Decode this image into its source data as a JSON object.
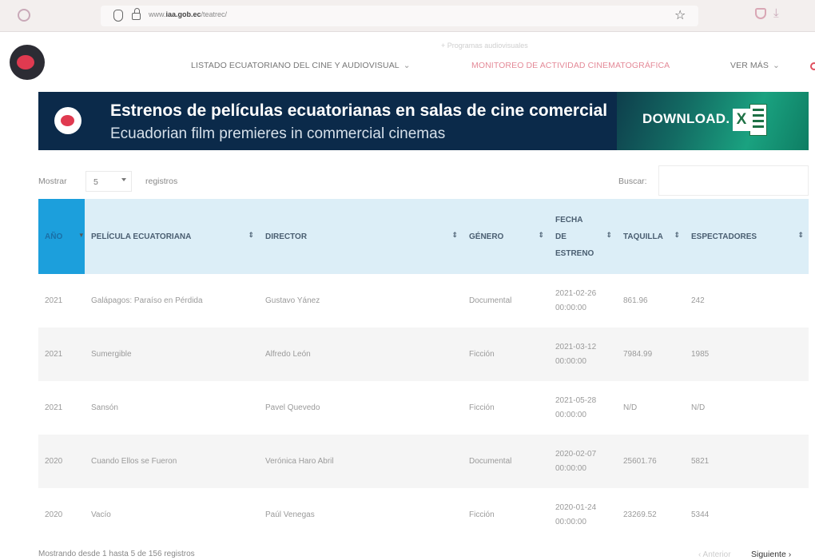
{
  "browser": {
    "url_prefix": "www.",
    "url_domain": "iaa.gob.ec",
    "url_path": "/teatrec/"
  },
  "nav": {
    "hint": "+ Programas audiovisuales",
    "items": [
      {
        "label": "LISTADO ECUATORIANO DEL CINE Y AUDIOVISUAL",
        "chevron": "⌄"
      },
      {
        "label": "MONITOREO DE ACTIVIDAD CINEMATOGRÁFICA"
      },
      {
        "label": "VER MÁS",
        "chevron": "⌄"
      }
    ]
  },
  "banner": {
    "title": "Estrenos de películas ecuatorianas en salas de cine comercial",
    "subtitle": "Ecuadorian film premieres in commercial cinemas",
    "download_label": "DOWNLOAD.",
    "excel_letter": "X"
  },
  "controls": {
    "show_label": "Mostrar",
    "page_length": "5",
    "records_label": "registros",
    "search_label": "Buscar:",
    "search_value": ""
  },
  "table": {
    "columns": [
      {
        "label": "AÑO"
      },
      {
        "label": "PELÍCULA ECUATORIANA"
      },
      {
        "label": "DIRECTOR"
      },
      {
        "label": "GÉNERO"
      },
      {
        "label": "FECHA",
        "label2": "DE",
        "label3": "ESTRENO"
      },
      {
        "label": "TAQUILLA"
      },
      {
        "label": "ESPECTADORES"
      }
    ],
    "sort_glyph": "⇕",
    "sorted_glyph": "▾",
    "rows": [
      {
        "year": "2021",
        "film": "Galápagos: Paraíso en Pérdida",
        "director": "Gustavo Yánez",
        "genre": "Documental",
        "date": "2021-02-26",
        "time": "00:00:00",
        "box_office": "861.96",
        "viewers": "242"
      },
      {
        "year": "2021",
        "film": "Sumergible",
        "director": "Alfredo León",
        "genre": "Ficción",
        "date": "2021-03-12",
        "time": "00:00:00",
        "box_office": "7984.99",
        "viewers": "1985"
      },
      {
        "year": "2021",
        "film": "Sansón",
        "director": "Pavel Quevedo",
        "genre": "Ficción",
        "date": "2021-05-28",
        "time": "00:00:00",
        "box_office": "N/D",
        "viewers": "N/D"
      },
      {
        "year": "2020",
        "film": "Cuando Ellos se Fueron",
        "director": "Verónica Haro Abril",
        "genre": "Documental",
        "date": "2020-02-07",
        "time": "00:00:00",
        "box_office": "25601.76",
        "viewers": "5821"
      },
      {
        "year": "2020",
        "film": "Vacío",
        "director": "Paúl Venegas",
        "genre": "Ficción",
        "date": "2020-01-24",
        "time": "00:00:00",
        "box_office": "23269.52",
        "viewers": "5344"
      }
    ]
  },
  "footer": {
    "info": "Mostrando desde 1 hasta 5 de 156 registros",
    "prev_label": "‹ Anterior",
    "next_label": "Siguiente ›"
  }
}
